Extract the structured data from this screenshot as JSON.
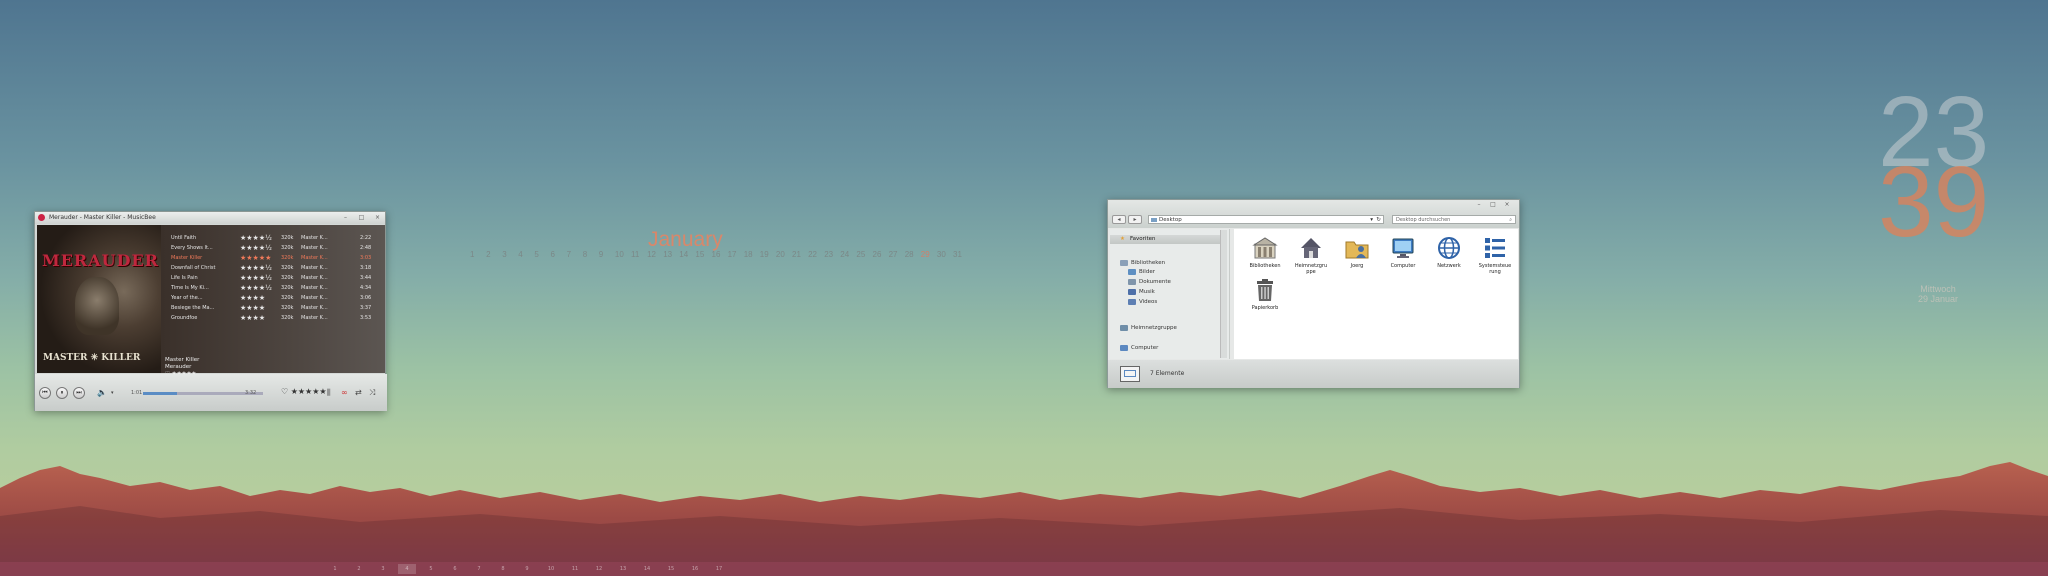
{
  "calendar": {
    "month": "January",
    "days": [
      "1",
      "2",
      "3",
      "4",
      "5",
      "6",
      "7",
      "8",
      "9",
      "10",
      "11",
      "12",
      "13",
      "14",
      "15",
      "16",
      "17",
      "18",
      "19",
      "20",
      "21",
      "22",
      "23",
      "24",
      "25",
      "26",
      "27",
      "28",
      "29",
      "30",
      "31"
    ],
    "today": "29"
  },
  "clock": {
    "hour": "23",
    "minute": "39",
    "weekday": "Mittwoch",
    "date": "29 Januar"
  },
  "musicbee": {
    "title": "Merauder - Master Killer - MusicBee",
    "art_band": "MERAUDER",
    "art_album": "MASTER ✳ KILLER",
    "tracks": [
      {
        "name": "Until Faith",
        "rating": "★★★★½",
        "bitrate": "320k",
        "artist": "Master K...",
        "time": "2:22"
      },
      {
        "name": "Every Shows It...",
        "rating": "★★★★½",
        "bitrate": "320k",
        "artist": "Master K...",
        "time": "2:48"
      },
      {
        "name": "Master Killer",
        "rating": "★★★★★",
        "bitrate": "320k",
        "artist": "Master K...",
        "time": "3:03"
      },
      {
        "name": "Downfall of Christ",
        "rating": "★★★★½",
        "bitrate": "320k",
        "artist": "Master K...",
        "time": "3:18"
      },
      {
        "name": "Life Is Pain",
        "rating": "★★★★½",
        "bitrate": "320k",
        "artist": "Master K...",
        "time": "3:44"
      },
      {
        "name": "Time Is My Ki...",
        "rating": "★★★★½",
        "bitrate": "320k",
        "artist": "Master K...",
        "time": "4:34"
      },
      {
        "name": "Year of the...",
        "rating": "★★★★",
        "bitrate": "320k",
        "artist": "Master K...",
        "time": "3:06"
      },
      {
        "name": "Besiege the Ma...",
        "rating": "★★★★",
        "bitrate": "320k",
        "artist": "Master K...",
        "time": "3:37"
      },
      {
        "name": "Groundfoe",
        "rating": "★★★★",
        "bitrate": "320k",
        "artist": "Master K...",
        "time": "3:53"
      }
    ],
    "playing_index": 2,
    "now_album": "Master Killer",
    "now_artist": "Merauder",
    "now_rating": "♡ ★★★★★",
    "elapsed": "1:01",
    "total": "3:32",
    "progress": 0.28,
    "ctrl_rating": "♡ ★★★★★"
  },
  "explorer": {
    "address": "Desktop",
    "search_placeholder": "Desktop durchsuchen",
    "favorites": "Favoriten",
    "sidebar": [
      {
        "label": "Bibliotheken",
        "color": "#8aa0b8"
      },
      {
        "label": "Bilder",
        "color": "#5d8fc2"
      },
      {
        "label": "Dokumente",
        "color": "#7f95ab"
      },
      {
        "label": "Musik",
        "color": "#4d6fa8"
      },
      {
        "label": "Videos",
        "color": "#5d7fb3"
      },
      {
        "label": "Heimnetzgruppe",
        "color": "#6f8ea8"
      },
      {
        "label": "Computer",
        "color": "#5b88c0"
      }
    ],
    "icons": [
      {
        "label": "Bibliotheken",
        "icon": "library-icon"
      },
      {
        "label": "Heimnetzgru ppe",
        "icon": "homegroup-icon"
      },
      {
        "label": "Joerg",
        "icon": "user-folder-icon"
      },
      {
        "label": "Computer",
        "icon": "computer-icon"
      },
      {
        "label": "Netzwerk",
        "icon": "network-icon"
      },
      {
        "label": "Systemsteue rung",
        "icon": "control-panel-icon"
      },
      {
        "label": "Papierkorb",
        "icon": "recycle-bin-icon"
      }
    ],
    "status": "7 Elemente"
  },
  "taskbar": {
    "items": [
      "1",
      "2",
      "3",
      "4",
      "5",
      "6",
      "7",
      "8",
      "9",
      "10",
      "11",
      "12",
      "13",
      "14",
      "15",
      "16",
      "17"
    ]
  },
  "colors": {
    "accent": "#d9876a",
    "taskbar": "#96465a"
  }
}
